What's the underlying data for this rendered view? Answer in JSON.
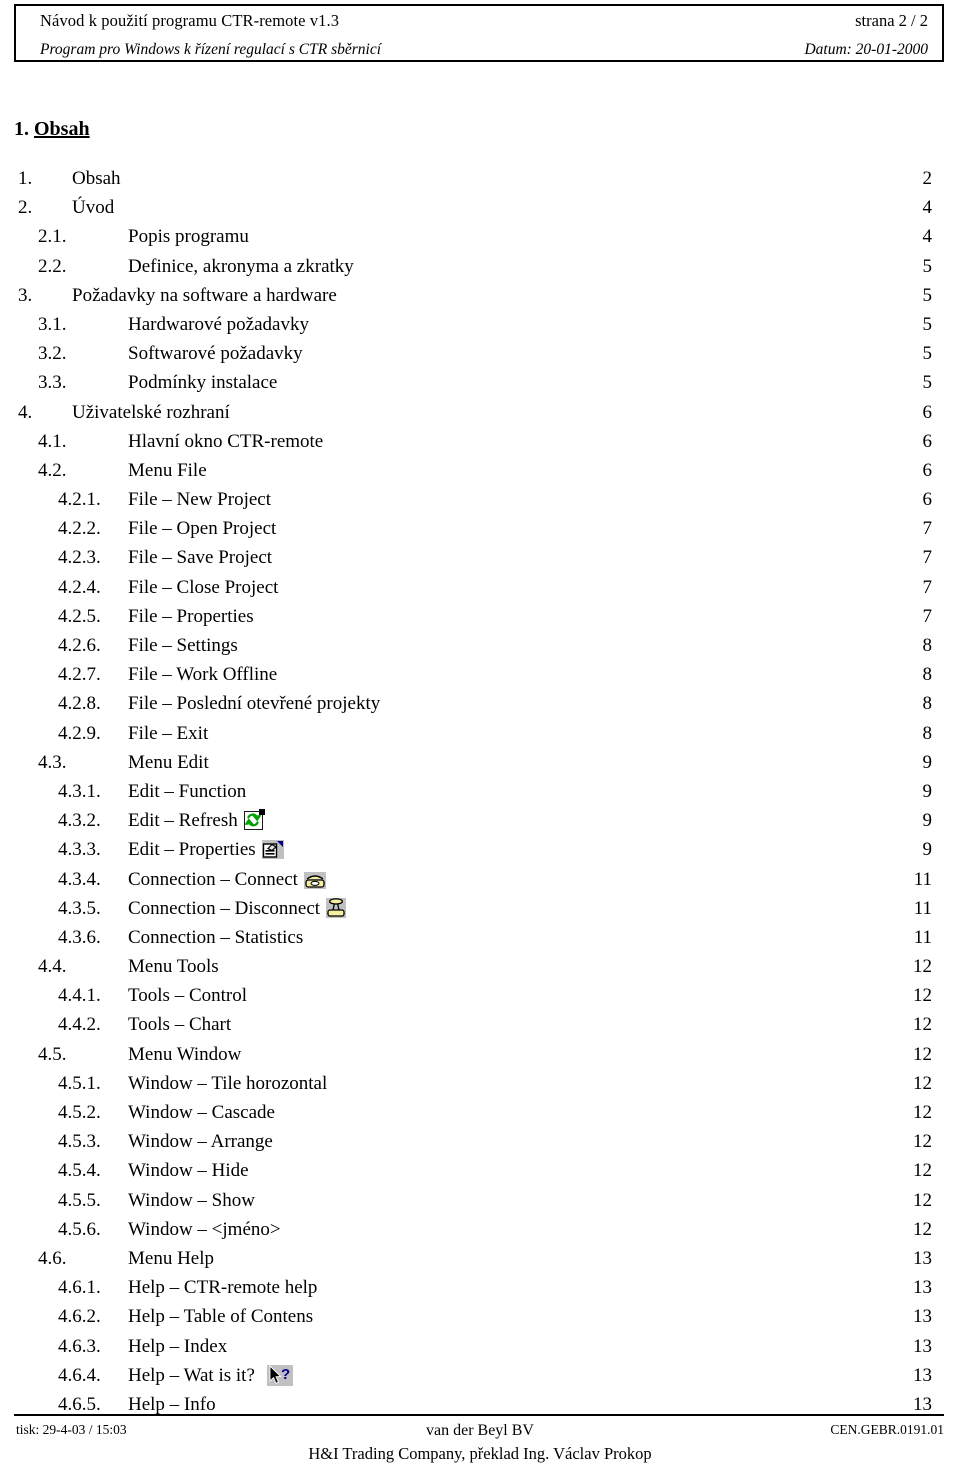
{
  "header": {
    "title": "Návod k použití programu CTR-remote v1.3",
    "page_label": "strana  2 / 2",
    "subtitle": "Program pro Windows k řízení regulací s CTR sběrnicí",
    "date_label": "Datum:  20-01-2000"
  },
  "heading": {
    "number": "1. ",
    "title": "Obsah"
  },
  "toc": [
    {
      "level": 1,
      "number": "1.",
      "text": "Obsah",
      "page": "2"
    },
    {
      "level": 1,
      "number": "2.",
      "text": "Úvod",
      "page": "4"
    },
    {
      "level": 2,
      "number": "2.1.",
      "text": "Popis programu",
      "page": "4"
    },
    {
      "level": 2,
      "number": "2.2.",
      "text": "Definice, akronyma a zkratky",
      "page": "5"
    },
    {
      "level": 1,
      "number": "3.",
      "text": "Požadavky na software a hardware",
      "page": "5"
    },
    {
      "level": 2,
      "number": "3.1.",
      "text": "Hardwarové požadavky",
      "page": "5"
    },
    {
      "level": 2,
      "number": "3.2.",
      "text": "Softwarové požadavky",
      "page": "5"
    },
    {
      "level": 2,
      "number": "3.3.",
      "text": "Podmínky instalace",
      "page": "5"
    },
    {
      "level": 1,
      "number": "4.",
      "text": "Uživatelské rozhraní",
      "page": "6"
    },
    {
      "level": 2,
      "number": "4.1.",
      "text": "Hlavní okno CTR-remote",
      "page": "6"
    },
    {
      "level": 2,
      "number": "4.2.",
      "text": "Menu File",
      "page": "6"
    },
    {
      "level": 3,
      "number": "4.2.1.",
      "text": "File – New Project",
      "page": "6"
    },
    {
      "level": 3,
      "number": "4.2.2.",
      "text": "File – Open Project",
      "page": "7"
    },
    {
      "level": 3,
      "number": "4.2.3.",
      "text": "File – Save Project",
      "page": "7"
    },
    {
      "level": 3,
      "number": "4.2.4.",
      "text": "File – Close Project",
      "page": "7"
    },
    {
      "level": 3,
      "number": "4.2.5.",
      "text": "File – Properties",
      "page": "7"
    },
    {
      "level": 3,
      "number": "4.2.6.",
      "text": "File – Settings",
      "page": "8"
    },
    {
      "level": 3,
      "number": "4.2.7.",
      "text": "File – Work Offline",
      "page": "8"
    },
    {
      "level": 3,
      "number": "4.2.8.",
      "text": "File – Poslední otevřené projekty",
      "page": "8"
    },
    {
      "level": 3,
      "number": "4.2.9.",
      "text": "File – Exit",
      "page": "8"
    },
    {
      "level": 2,
      "number": "4.3.",
      "text": "Menu Edit",
      "page": "9"
    },
    {
      "level": 3,
      "number": "4.3.1.",
      "text": "Edit – Function",
      "page": "9"
    },
    {
      "level": 3,
      "number": "4.3.2.",
      "text": "Edit – Refresh",
      "page": "9",
      "icon": "refresh-icon"
    },
    {
      "level": 3,
      "number": "4.3.3.",
      "text": "Edit – Properties",
      "page": "9",
      "icon": "properties-icon"
    },
    {
      "level": 3,
      "number": "4.3.4.",
      "text": "Connection – Connect",
      "page": "11",
      "icon": "telephone-connect-icon"
    },
    {
      "level": 3,
      "number": "4.3.5.",
      "text": "Connection – Disconnect",
      "page": "11",
      "icon": "telephone-disconnect-icon"
    },
    {
      "level": 3,
      "number": "4.3.6.",
      "text": "Connection – Statistics",
      "page": "11"
    },
    {
      "level": 2,
      "number": "4.4.",
      "text": "Menu Tools",
      "page": "12"
    },
    {
      "level": 3,
      "number": "4.4.1.",
      "text": "Tools – Control",
      "page": "12"
    },
    {
      "level": 3,
      "number": "4.4.2.",
      "text": "Tools – Chart",
      "page": "12"
    },
    {
      "level": 2,
      "number": "4.5.",
      "text": "Menu Window",
      "page": "12"
    },
    {
      "level": 3,
      "number": "4.5.1.",
      "text": "Window – Tile horozontal",
      "page": "12"
    },
    {
      "level": 3,
      "number": "4.5.2.",
      "text": "Window – Cascade",
      "page": "12"
    },
    {
      "level": 3,
      "number": "4.5.3.",
      "text": "Window – Arrange",
      "page": "12"
    },
    {
      "level": 3,
      "number": "4.5.4.",
      "text": "Window – Hide",
      "page": "12"
    },
    {
      "level": 3,
      "number": "4.5.5.",
      "text": "Window – Show",
      "page": "12"
    },
    {
      "level": 3,
      "number": "4.5.6.",
      "text": "Window – <jméno>",
      "page": "12"
    },
    {
      "level": 2,
      "number": "4.6.",
      "text": "Menu Help",
      "page": "13"
    },
    {
      "level": 3,
      "number": "4.6.1.",
      "text": "Help – CTR-remote help",
      "page": "13"
    },
    {
      "level": 3,
      "number": "4.6.2.",
      "text": "Help – Table of Contens",
      "page": "13"
    },
    {
      "level": 3,
      "number": "4.6.3.",
      "text": "Help – Index",
      "page": "13"
    },
    {
      "level": 3,
      "number": "4.6.4.",
      "text": "Help – Wat is it?",
      "page": "13",
      "icon": "what-is-it-cursor-icon"
    },
    {
      "level": 3,
      "number": "4.6.5.",
      "text": "Help – Info",
      "page": "13"
    }
  ],
  "footer": {
    "print_info": "tisk: 29-4-03 / 15:03",
    "company": "van der Beyl BV",
    "doc_code": "CEN.GEBR.0191.01",
    "translator_line": "H&I Trading Company, překlad Ing. Václav Prokop"
  },
  "colors": {
    "text": "#000000",
    "rule": "#000000",
    "icon_face": "#c0c0c0",
    "refresh_green": "#00a000",
    "blue_accent": "#00008b",
    "phone_yellow": "#f5f0a0"
  }
}
